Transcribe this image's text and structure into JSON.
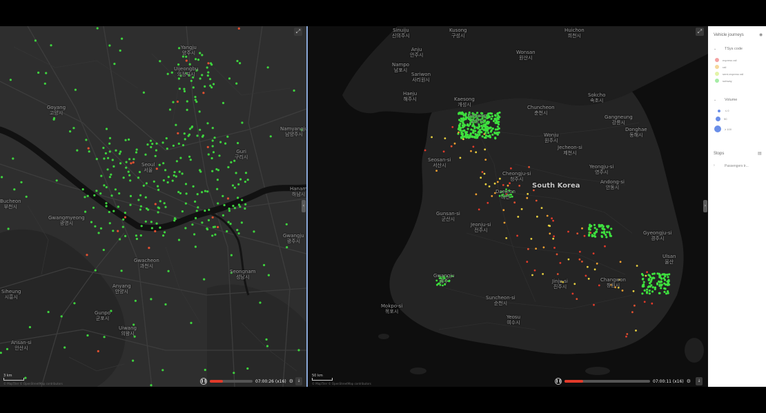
{
  "left_map": {
    "labels": {
      "yangju": {
        "en": "Yangju",
        "ko": "양주시"
      },
      "uijeongbu": {
        "en": "Uijeongbu",
        "ko": "의정부시"
      },
      "goyang": {
        "en": "Goyang",
        "ko": "고양시"
      },
      "namyangju": {
        "en": "Namyangju",
        "ko": "남양주시"
      },
      "guri": {
        "en": "Guri",
        "ko": "구리시"
      },
      "seoul": {
        "en": "Seoul",
        "ko": "서울"
      },
      "hanam": {
        "en": "Hanam",
        "ko": "하남시"
      },
      "bucheon": {
        "en": "Bucheon",
        "ko": "부천시"
      },
      "gwangmyeong": {
        "en": "Gwangmyeong",
        "ko": "광명시"
      },
      "gwacheon": {
        "en": "Gwacheon",
        "ko": "과천시"
      },
      "seongnam": {
        "en": "Seongnam",
        "ko": "성남시"
      },
      "anyang": {
        "en": "Anyang",
        "ko": "안양시"
      },
      "siheung": {
        "en": "Siheung",
        "ko": "시흥시"
      },
      "gunpo": {
        "en": "Gunpo",
        "ko": "군포시"
      },
      "uiwang": {
        "en": "Uiwang",
        "ko": "의왕시"
      },
      "ansan": {
        "en": "Ansan-si",
        "ko": "안산시"
      },
      "gwangju_gg": {
        "en": "Gwangju",
        "ko": "광주시"
      }
    },
    "scale": "3 km",
    "attribution": "© MapTiler © OpenStreetMap contributors",
    "time": "07:00:26 (x16)",
    "progress": 0.3
  },
  "right_map": {
    "labels": {
      "sinuiju": {
        "en": "Sinuiju",
        "ko": "신의주시"
      },
      "kusong": {
        "en": "Kusong",
        "ko": "구성시"
      },
      "huichon": {
        "en": "Huichon",
        "ko": "희천시"
      },
      "anju": {
        "en": "Anju",
        "ko": "안주시"
      },
      "wonsan": {
        "en": "Wonsan",
        "ko": "원산시"
      },
      "nampo": {
        "en": "Nampo",
        "ko": "남포시"
      },
      "sariwon": {
        "en": "Sariwon",
        "ko": "사리원시"
      },
      "haeju": {
        "en": "Haeju",
        "ko": "해주시"
      },
      "kaesong": {
        "en": "Kaesong",
        "ko": "개성시"
      },
      "sokcho": {
        "en": "Sokcho",
        "ko": "속초시"
      },
      "chuncheon": {
        "en": "Chuncheon",
        "ko": "춘천시"
      },
      "gangneung": {
        "en": "Gangneung",
        "ko": "강릉시"
      },
      "donghae": {
        "en": "Donghae",
        "ko": "동해시"
      },
      "goyang": {
        "en": "Goyang",
        "ko": "고양시"
      },
      "wonju": {
        "en": "Wonju",
        "ko": "원주시"
      },
      "jecheon": {
        "en": "Jecheon-si",
        "ko": "제천시"
      },
      "seosan": {
        "en": "Seosan-si",
        "ko": "서산시"
      },
      "yeongju": {
        "en": "Yeongju-si",
        "ko": "영주시"
      },
      "cheongju": {
        "en": "Cheongju-si",
        "ko": "청주시"
      },
      "andong": {
        "en": "Andong-si",
        "ko": "안동시"
      },
      "south_korea": {
        "en": "South Korea"
      },
      "daejeon": {
        "en": "Daejeon",
        "ko": "대전"
      },
      "gunsan": {
        "en": "Gunsan-si",
        "ko": "군산시"
      },
      "jeonju": {
        "en": "Jeonju-si",
        "ko": "전주시"
      },
      "gyeongju": {
        "en": "Gyeongju-si",
        "ko": "경주시"
      },
      "ulsan": {
        "en": "Ulsan",
        "ko": "울산"
      },
      "jinju": {
        "en": "Jinju-si",
        "ko": "진주시"
      },
      "changwon": {
        "en": "Changwon",
        "ko": "창원시"
      },
      "gwangju": {
        "en": "Gwangju",
        "ko": "광주"
      },
      "suncheon": {
        "en": "Suncheon-si",
        "ko": "순천시"
      },
      "mokpo": {
        "en": "Mokpo-si",
        "ko": "목포시"
      },
      "yeosu": {
        "en": "Yeosu",
        "ko": "여수시"
      }
    },
    "scale": "50 km",
    "attribution": "© MapTiler © OpenStreetMap contributors",
    "time": "07:00:11 (x16)",
    "progress": 0.22
  },
  "sidebar": {
    "title": "Vehicle journeys",
    "tsys_header": "TSys code",
    "tsys_items": [
      {
        "label": "express rail",
        "color": "#f08080"
      },
      {
        "label": "rail",
        "color": "#f0c070"
      },
      {
        "label": "semi-express rail",
        "color": "#d8f07a"
      },
      {
        "label": "subway",
        "color": "#7ae07a"
      }
    ],
    "volume_header": "Volume",
    "volume_items": [
      {
        "label": "≤ 0"
      },
      {
        "label": "50"
      },
      {
        "label": "≥ 100"
      }
    ],
    "stops_title": "Stops",
    "stops_item": "Passengers tr..."
  }
}
